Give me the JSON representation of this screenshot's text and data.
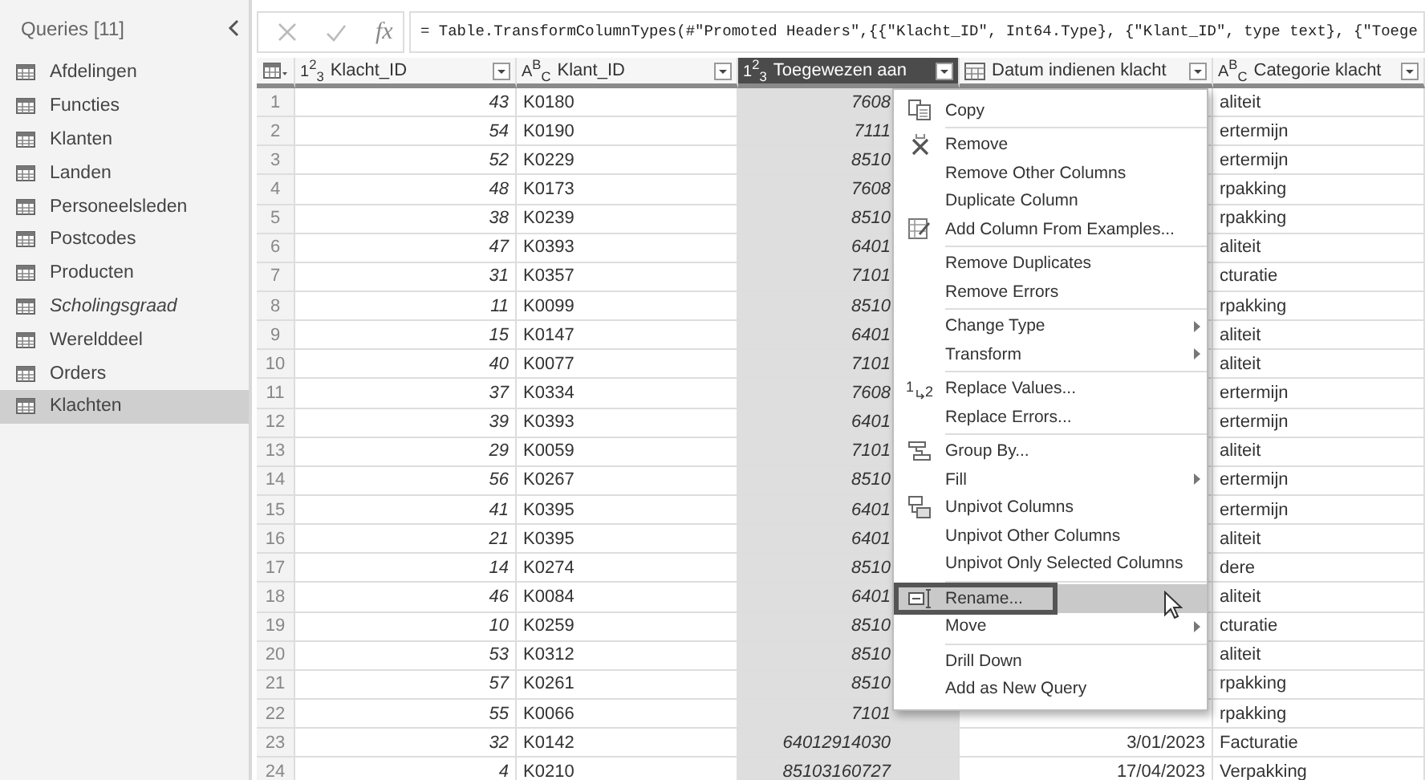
{
  "sidebar": {
    "title": "Queries [11]",
    "items": [
      {
        "label": "Afdelingen",
        "selected": false,
        "load_enabled": true
      },
      {
        "label": "Functies",
        "selected": false,
        "load_enabled": true
      },
      {
        "label": "Klanten",
        "selected": false,
        "load_enabled": true
      },
      {
        "label": "Landen",
        "selected": false,
        "load_enabled": true
      },
      {
        "label": "Personeelsleden",
        "selected": false,
        "load_enabled": true
      },
      {
        "label": "Postcodes",
        "selected": false,
        "load_enabled": true
      },
      {
        "label": "Producten",
        "selected": false,
        "load_enabled": true
      },
      {
        "label": "Scholingsgraad",
        "selected": false,
        "load_enabled": false
      },
      {
        "label": "Werelddeel",
        "selected": false,
        "load_enabled": true
      },
      {
        "label": "Orders",
        "selected": false,
        "load_enabled": true
      },
      {
        "label": "Klachten",
        "selected": true,
        "load_enabled": true
      }
    ]
  },
  "formula_bar": {
    "fx": "fx",
    "formula": "= Table.TransformColumnTypes(#\"Promoted Headers\",{{\"Klacht_ID\", Int64.Type}, {\"Klant_ID\", type text}, {\"Toege"
  },
  "table": {
    "columns": [
      {
        "kind": "number",
        "type_label": "1$^{2}$$_{3}$",
        "name": "Klacht_ID",
        "selected": false
      },
      {
        "kind": "text",
        "type_label": "A$^{B}$$_{C}$",
        "name": "Klant_ID",
        "selected": false
      },
      {
        "kind": "number",
        "type_label": "1$^{2}$$_{3}$",
        "name": "Toegewezen aan",
        "selected": true
      },
      {
        "kind": "date",
        "name": "Datum indienen klacht",
        "selected": false
      },
      {
        "kind": "text",
        "type_label": "A$^{B}$$_{C}$",
        "name": "Categorie klacht",
        "selected": false
      }
    ],
    "rows": [
      {
        "n": "1",
        "cells": [
          "43",
          "K0180",
          "7608",
          null,
          "aliteit"
        ]
      },
      {
        "n": "2",
        "cells": [
          "54",
          "K0190",
          "7111",
          null,
          "ertermijn"
        ]
      },
      {
        "n": "3",
        "cells": [
          "52",
          "K0229",
          "8510",
          null,
          "ertermijn"
        ]
      },
      {
        "n": "4",
        "cells": [
          "48",
          "K0173",
          "7608",
          null,
          "rpakking"
        ]
      },
      {
        "n": "5",
        "cells": [
          "38",
          "K0239",
          "8510",
          null,
          "rpakking"
        ]
      },
      {
        "n": "6",
        "cells": [
          "47",
          "K0393",
          "6401",
          null,
          "aliteit"
        ]
      },
      {
        "n": "7",
        "cells": [
          "31",
          "K0357",
          "7101",
          null,
          "cturatie"
        ]
      },
      {
        "n": "8",
        "cells": [
          "11",
          "K0099",
          "8510",
          null,
          "rpakking"
        ]
      },
      {
        "n": "9",
        "cells": [
          "15",
          "K0147",
          "6401",
          null,
          "aliteit"
        ]
      },
      {
        "n": "10",
        "cells": [
          "40",
          "K0077",
          "7101",
          null,
          "aliteit"
        ]
      },
      {
        "n": "11",
        "cells": [
          "37",
          "K0334",
          "7608",
          null,
          "ertermijn"
        ]
      },
      {
        "n": "12",
        "cells": [
          "39",
          "K0393",
          "6401",
          null,
          "ertermijn"
        ]
      },
      {
        "n": "13",
        "cells": [
          "29",
          "K0059",
          "7101",
          null,
          "aliteit"
        ]
      },
      {
        "n": "14",
        "cells": [
          "56",
          "K0267",
          "8510",
          null,
          "ertermijn"
        ]
      },
      {
        "n": "15",
        "cells": [
          "41",
          "K0395",
          "6401",
          null,
          "ertermijn"
        ]
      },
      {
        "n": "16",
        "cells": [
          "21",
          "K0395",
          "6401",
          null,
          "aliteit"
        ]
      },
      {
        "n": "17",
        "cells": [
          "14",
          "K0274",
          "8510",
          null,
          "dere"
        ]
      },
      {
        "n": "18",
        "cells": [
          "46",
          "K0084",
          "6401",
          null,
          "aliteit"
        ]
      },
      {
        "n": "19",
        "cells": [
          "10",
          "K0259",
          "8510",
          null,
          "cturatie"
        ]
      },
      {
        "n": "20",
        "cells": [
          "53",
          "K0312",
          "8510",
          null,
          "aliteit"
        ]
      },
      {
        "n": "21",
        "cells": [
          "57",
          "K0261",
          "8510",
          null,
          "rpakking"
        ]
      },
      {
        "n": "22",
        "cells": [
          "55",
          "K0066",
          "7101",
          null,
          "rpakking"
        ]
      },
      {
        "n": "23",
        "cells": [
          "32",
          "K0142",
          "64012914030",
          "3/01/2023",
          "Facturatie"
        ]
      },
      {
        "n": "24",
        "cells": [
          "4",
          "K0210",
          "85103160727",
          "17/04/2023",
          "Verpakking"
        ]
      }
    ]
  },
  "context_menu": {
    "groups": [
      {
        "items": [
          {
            "kind": "copy",
            "label": "Copy",
            "submenu": false,
            "selected": false
          }
        ]
      },
      {
        "items": [
          {
            "kind": "remove",
            "label": "Remove",
            "submenu": false,
            "selected": false
          },
          {
            "kind": "plain",
            "label": "Remove Other Columns",
            "submenu": false,
            "selected": false
          },
          {
            "kind": "plain",
            "label": "Duplicate Column",
            "submenu": false,
            "selected": false
          },
          {
            "kind": "examples",
            "label": "Add Column From Examples...",
            "submenu": false,
            "selected": false
          }
        ]
      },
      {
        "items": [
          {
            "kind": "plain",
            "label": "Remove Duplicates",
            "submenu": false,
            "selected": false
          },
          {
            "kind": "plain",
            "label": "Remove Errors",
            "submenu": false,
            "selected": false
          }
        ]
      },
      {
        "items": [
          {
            "kind": "plain",
            "label": "Change Type",
            "submenu": true,
            "selected": false
          },
          {
            "kind": "plain",
            "label": "Transform",
            "submenu": true,
            "selected": false
          }
        ]
      },
      {
        "items": [
          {
            "kind": "replace",
            "label": "Replace Values...",
            "submenu": false,
            "selected": false,
            "icon_label": "1",
            "icon_sub": "2"
          },
          {
            "kind": "plain",
            "label": "Replace Errors...",
            "submenu": false,
            "selected": false
          }
        ]
      },
      {
        "items": [
          {
            "kind": "group",
            "label": "Group By...",
            "submenu": false,
            "selected": false
          },
          {
            "kind": "plain",
            "label": "Fill",
            "submenu": true,
            "selected": false
          },
          {
            "kind": "unpivot",
            "label": "Unpivot Columns",
            "submenu": false,
            "selected": false
          },
          {
            "kind": "plain",
            "label": "Unpivot Other Columns",
            "submenu": false,
            "selected": false
          },
          {
            "kind": "plain",
            "label": "Unpivot Only Selected Columns",
            "submenu": false,
            "selected": false
          }
        ]
      },
      {
        "items": [
          {
            "kind": "rename",
            "label": "Rename...",
            "submenu": false,
            "selected": true
          },
          {
            "kind": "plain",
            "label": "Move",
            "submenu": true,
            "selected": false
          }
        ]
      },
      {
        "items": [
          {
            "kind": "plain",
            "label": "Drill Down",
            "submenu": false,
            "selected": false
          },
          {
            "kind": "plain",
            "label": "Add as New Query",
            "submenu": false,
            "selected": false
          }
        ]
      }
    ]
  }
}
